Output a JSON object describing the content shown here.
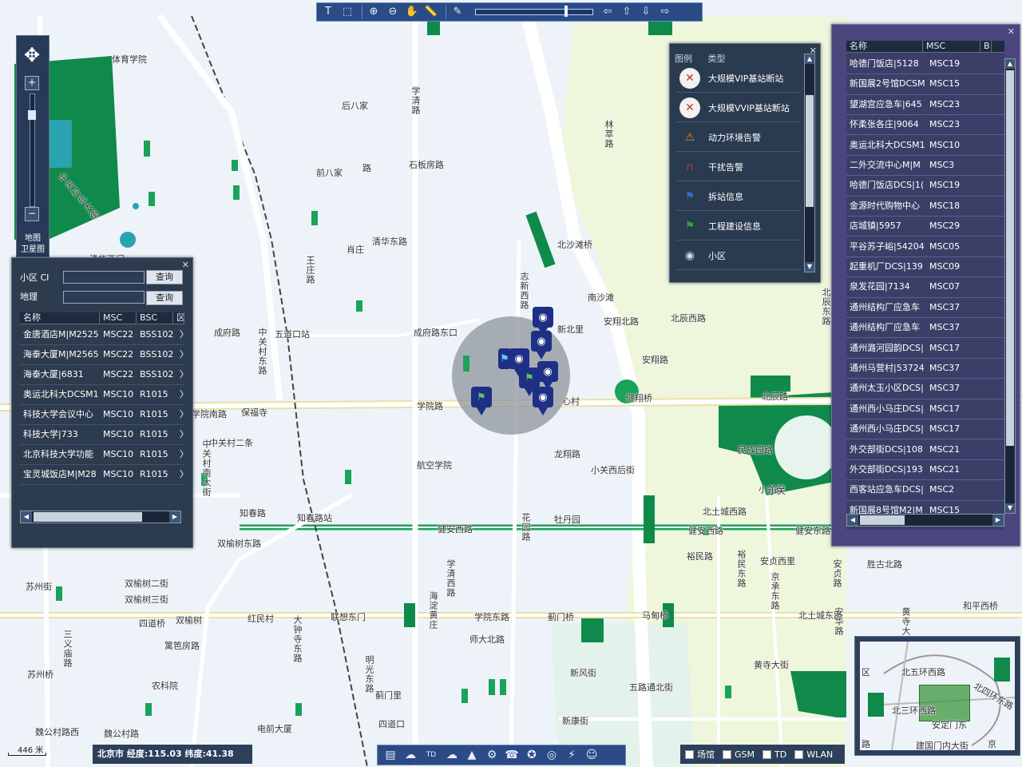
{
  "toolbar": {
    "tools": [
      "text-tool",
      "select-tool",
      "zoom-in",
      "zoom-out",
      "pan",
      "measure",
      "clear"
    ],
    "nav": [
      "prev-arrow",
      "up-arrow",
      "down-arrow",
      "next-arrow"
    ],
    "zoom_level": 0.78
  },
  "nav_control": {
    "zoom_in": "+",
    "zoom_out": "−",
    "zoom_level": 0.16,
    "map_label": "地图",
    "sat_label": "卫星图"
  },
  "map_labels": [
    "体育学院",
    "后八家",
    "前八家",
    "路",
    "石板房路",
    "学清路",
    "林萃路",
    "清华东路",
    "肖庄",
    "北沙滩桥",
    "南沙滩",
    "安翔北路",
    "北辰西路",
    "北辰东路",
    "成府路",
    "成府路东口",
    "五道口站",
    "学院路",
    "学院南路",
    "保福寺",
    "中关村二条",
    "航空学院",
    "志新西路",
    "新北里",
    "心村",
    "健翔桥",
    "北辰路",
    "安翔路",
    "民族园路",
    "龙翔路",
    "小关西后街",
    "小关街",
    "北土城西路",
    "知春路",
    "知春路站",
    "健安西路",
    "健安西路",
    "健安东路",
    "花园路",
    "牡丹园",
    "双榆树东路",
    "双榆树二街",
    "双榆树三街",
    "四道桥",
    "双榆树",
    "红民村",
    "联想东门",
    "学院东路",
    "马甸桥",
    "师大北路",
    "蓟门桥",
    "新风街",
    "黄寺大街",
    "苏州街",
    "苏州桥",
    "农科院",
    "篱笆房路",
    "五路通北街",
    "四道口",
    "新康街",
    "大钟寺东路",
    "明光东路",
    "魏公村路西",
    "魏公村路",
    "电前大厦",
    "清华西门",
    "王庄路",
    "中关村东路",
    "学清西路",
    "海淀黄庄",
    "中关村北大街",
    "安贞西里",
    "裕民东路",
    "裕民路",
    "胜古北路",
    "安贞路",
    "和平西桥",
    "京承东路",
    "黄寺大街",
    "北土城东路",
    "安华路",
    "小关",
    "中关村南大街",
    "三义庙路",
    "蓟门里"
  ],
  "search_panel": {
    "cell_label": "小区 CI",
    "addr_label": "地理",
    "cell_value": "",
    "addr_value": "",
    "query_btn": "查询",
    "columns": [
      "名称",
      "MSC",
      "BSC",
      "区"
    ],
    "rows": [
      [
        "金唐酒店M|M2525",
        "MSC22",
        "BSS102"
      ],
      [
        "海泰大厦M|M2565",
        "MSC22",
        "BSS102"
      ],
      [
        "海泰大厦|6831",
        "MSC22",
        "BSS102"
      ],
      [
        "奥运北科大DCSM1",
        "MSC10",
        "R1015"
      ],
      [
        "科技大学会议中心",
        "MSC10",
        "R1015"
      ],
      [
        "科技大学|733",
        "MSC10",
        "R1015"
      ],
      [
        "北京科技大学功能",
        "MSC10",
        "R1015"
      ],
      [
        "宝灵城饭店M|M28",
        "MSC10",
        "R1015"
      ]
    ],
    "hscroll_pos": 0.06
  },
  "legend": {
    "tab1": "图例",
    "tab2": "类型",
    "items": [
      {
        "label": "大规模VIP基站断站",
        "icon": "red-x-icon",
        "color": "#c0392b"
      },
      {
        "label": "大规模VVIP基站断站",
        "icon": "red-x-icon",
        "color": "#c0392b"
      },
      {
        "label": "动力环境告警",
        "icon": "warning-icon",
        "color": "#e67e22"
      },
      {
        "label": "干扰告警",
        "icon": "magnet-icon",
        "color": "#c0392b"
      },
      {
        "label": "拆站信息",
        "icon": "blue-flag-icon",
        "color": "#2e6fbf"
      },
      {
        "label": "工程建设信息",
        "icon": "green-flag-icon",
        "color": "#3a9a3a"
      },
      {
        "label": "小区",
        "icon": "antenna-icon",
        "color": "#cfd8e3"
      }
    ],
    "vscroll_pos": 0.36
  },
  "right_list": {
    "columns": [
      "名称",
      "MSC",
      "B"
    ],
    "rows": [
      [
        "哈德门饭店|5128",
        "MSC19"
      ],
      [
        "新国展2号馆DCSM",
        "MSC15"
      ],
      [
        "望湖宫应急车|645",
        "MSC23"
      ],
      [
        "怀柔张各庄|9064",
        "MSC23"
      ],
      [
        "奥运北科大DCSM1",
        "MSC10"
      ],
      [
        "二外交流中心M|M",
        "MSC3"
      ],
      [
        "哈德门饭店DCS|1(",
        "MSC19"
      ],
      [
        "金源时代购物中心",
        "MSC18"
      ],
      [
        "店城镇|5957",
        "MSC29"
      ],
      [
        "平谷苏子峪|54204",
        "MSC05"
      ],
      [
        "起重机厂DCS|139",
        "MSC09"
      ],
      [
        "泉发花园|7134",
        "MSC07"
      ],
      [
        "通州结构厂应急车",
        "MSC37"
      ],
      [
        "通州结构厂应急车",
        "MSC37"
      ],
      [
        "通州潞河园韵DCS|",
        "MSC17"
      ],
      [
        "通州马营村|53724",
        "MSC37"
      ],
      [
        "通州太玉小区DCS|",
        "MSC37"
      ],
      [
        "通州西小马庄DCS|",
        "MSC17"
      ],
      [
        "通州西小马庄DCS|",
        "MSC17"
      ],
      [
        "外交部街DCS|108",
        "MSC21"
      ],
      [
        "外交部街DCS|193",
        "MSC21"
      ],
      [
        "西客站应急车DCS|",
        "MSC2"
      ],
      [
        "新国展8号馆M2|M",
        "MSC15"
      ]
    ]
  },
  "status": {
    "location": "北京市 经度:115.03 纬度:41.38",
    "scale": "446 米"
  },
  "bottom_tools": [
    "list-icon",
    "china-map-icon",
    "td-icon",
    "cloud-icon",
    "tower-icon",
    "gear-icon",
    "phone-icon",
    "satellite-icon",
    "compass-icon",
    "signal-icon",
    "users-icon"
  ],
  "bottom_td": "TD",
  "network_filters": [
    {
      "label": "场馆",
      "checked": false
    },
    {
      "label": "GSM",
      "checked": false
    },
    {
      "label": "TD",
      "checked": false
    },
    {
      "label": "WLAN",
      "checked": false
    }
  ],
  "overview": {
    "labels": [
      "北五环西路",
      "北四环东路",
      "北三环西路",
      "安定门东",
      "建国门内大街",
      "京",
      "路",
      "区"
    ]
  }
}
